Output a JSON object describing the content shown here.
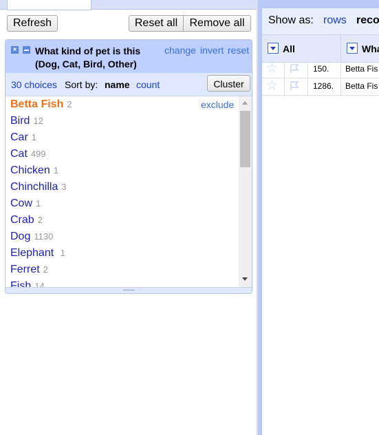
{
  "left_panel": {
    "buttons": {
      "refresh": "Refresh",
      "reset_all": "Reset all",
      "remove_all": "Remove all"
    },
    "facet": {
      "title": "What kind of pet is this (Dog, Cat, Bird, Other)",
      "actions": {
        "change": "change",
        "invert": "invert",
        "reset": "reset"
      },
      "choices_count": "30 choices",
      "sort_by_label": "Sort by:",
      "sort_name": "name",
      "sort_count": "count",
      "cluster": "Cluster",
      "exclude": "exclude",
      "items": [
        {
          "name": "Betta Fish",
          "count": "2"
        },
        {
          "name": "Bird",
          "count": "12"
        },
        {
          "name": "Car",
          "count": "1"
        },
        {
          "name": "Cat",
          "count": "499"
        },
        {
          "name": "Chicken",
          "count": "1"
        },
        {
          "name": "Chinchilla",
          "count": "3"
        },
        {
          "name": "Cow",
          "count": "1"
        },
        {
          "name": "Crab",
          "count": "2"
        },
        {
          "name": "Dog",
          "count": "1130"
        },
        {
          "name": "Elephant ",
          "count": "1"
        },
        {
          "name": "Ferret",
          "count": "2"
        },
        {
          "name": "Fish",
          "count": "14"
        }
      ],
      "selected_item": "Betta Fish"
    }
  },
  "right_panel": {
    "show_as": "Show as:",
    "rows": "rows",
    "records": "reco",
    "columns": {
      "all": "All",
      "what": "Wha"
    },
    "rows_data": [
      {
        "num": "150.",
        "value": "Betta Fis"
      },
      {
        "num": "1286.",
        "value": "Betta Fis"
      }
    ]
  },
  "colors": {
    "selected": "#ef7216",
    "link": "#1a1fb8",
    "facet_header": "#bdd0ff"
  }
}
